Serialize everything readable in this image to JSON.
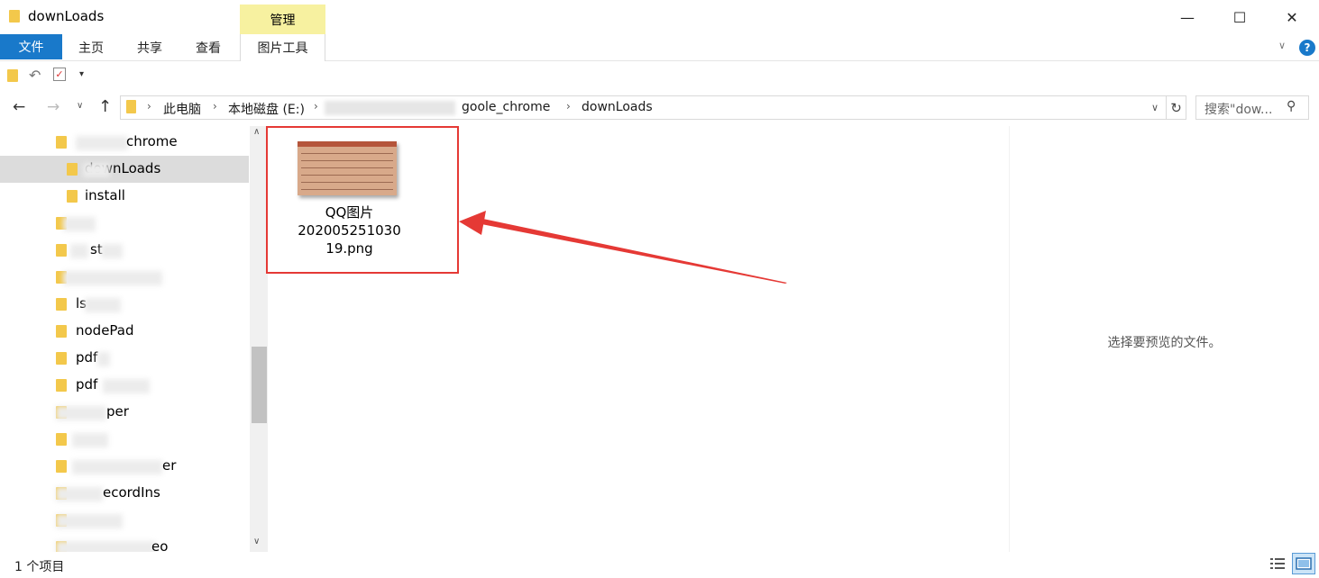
{
  "window": {
    "title": "downLoads",
    "minimize_glyph": "—",
    "maximize_glyph": "☐",
    "close_glyph": "✕"
  },
  "ribbon": {
    "context_header": "管理",
    "tabs": [
      {
        "label": "文件",
        "active": true
      },
      {
        "label": "主页"
      },
      {
        "label": "共享"
      },
      {
        "label": "查看"
      },
      {
        "label": "图片工具"
      }
    ],
    "help_glyph": "?"
  },
  "quick_access": {
    "undo_icon": "undo-icon",
    "properties_icon": "checkmark-icon"
  },
  "navigation": {
    "back_glyph": "←",
    "forward_glyph": "→",
    "recent_glyph": "∨",
    "up_glyph": "↑"
  },
  "address": {
    "crumbs": [
      "此电脑",
      "本地磁盘 (E:)",
      "goole_chrome",
      "downLoads"
    ]
  },
  "search": {
    "placeholder": "搜索\"dow..."
  },
  "nav_pane": {
    "items": [
      {
        "label": "chrome",
        "indent": 1
      },
      {
        "label": "downLoads",
        "indent": 2,
        "selected": true
      },
      {
        "label": "install",
        "indent": 2
      },
      {
        "label": "",
        "indent": 1
      },
      {
        "label": "st",
        "indent": 1
      },
      {
        "label": "",
        "indent": 1
      },
      {
        "label": "ls",
        "indent": 1
      },
      {
        "label": "nodePad",
        "indent": 1
      },
      {
        "label": "pdf",
        "indent": 1
      },
      {
        "label": "pdf",
        "indent": 1
      },
      {
        "label": "per",
        "indent": 1
      },
      {
        "label": "",
        "indent": 1
      },
      {
        "label": "er",
        "indent": 1
      },
      {
        "label": "ecordIns",
        "indent": 1
      },
      {
        "label": "",
        "indent": 1
      },
      {
        "label": "eo",
        "indent": 1
      }
    ]
  },
  "files": [
    {
      "name_line1": "QQ图片",
      "name_line2": "202005251030",
      "name_line3": "19.png"
    }
  ],
  "preview": {
    "empty_text": "选择要预览的文件。"
  },
  "status": {
    "item_count": "1 个项目"
  },
  "colors": {
    "accent": "#1979ca",
    "highlight_border": "#e53935",
    "arrow": "#e53935",
    "manage_tab": "#f7f1a0"
  }
}
